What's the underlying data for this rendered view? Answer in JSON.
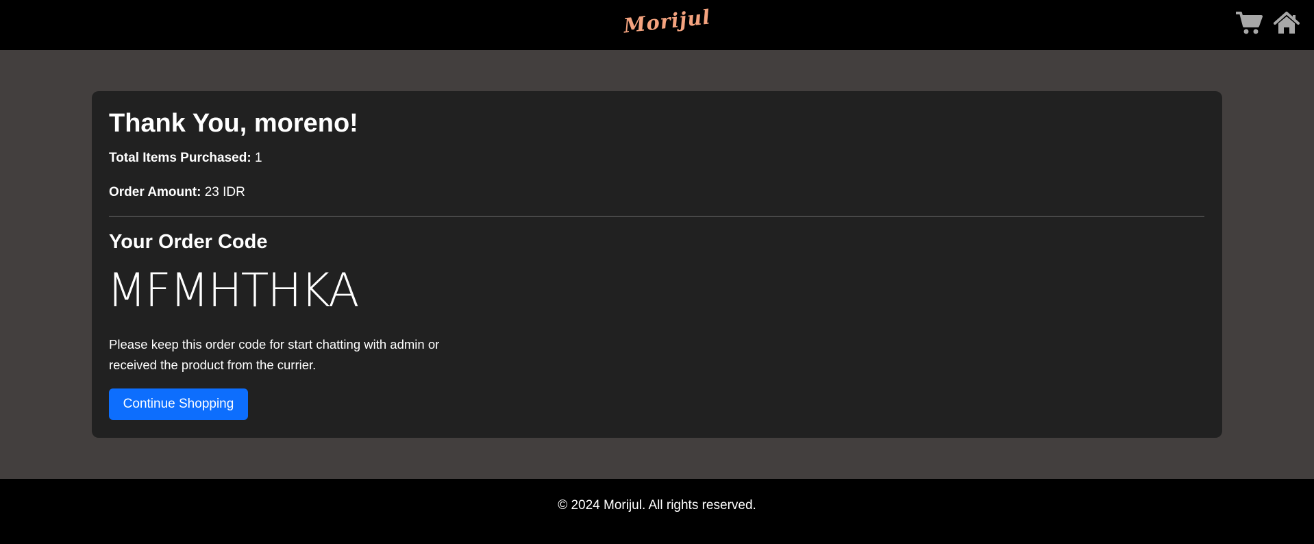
{
  "header": {
    "logo_text": "Morijul",
    "logo_color": "#f4a37f",
    "icons": [
      {
        "name": "cart-icon"
      },
      {
        "name": "home-icon"
      }
    ]
  },
  "order": {
    "thanks_title": "Thank You, moreno!",
    "items_label": "Total Items Purchased:",
    "items_value": "1",
    "amount_label": "Order Amount:",
    "amount_value": "23 IDR",
    "code_heading": "Your Order Code",
    "code": "MFMHTHKA",
    "note": "Please keep this order code for start chatting with admin or received the product from the currier.",
    "continue_label": "Continue Shopping"
  },
  "footer": {
    "copyright": "© 2024 Morijul. All rights reserved."
  },
  "colors": {
    "page_background": "#433f3e",
    "card_background": "#212121",
    "bar_background": "#000000",
    "button_primary": "#0d6efd",
    "icon_gray": "#a8a8a8"
  }
}
